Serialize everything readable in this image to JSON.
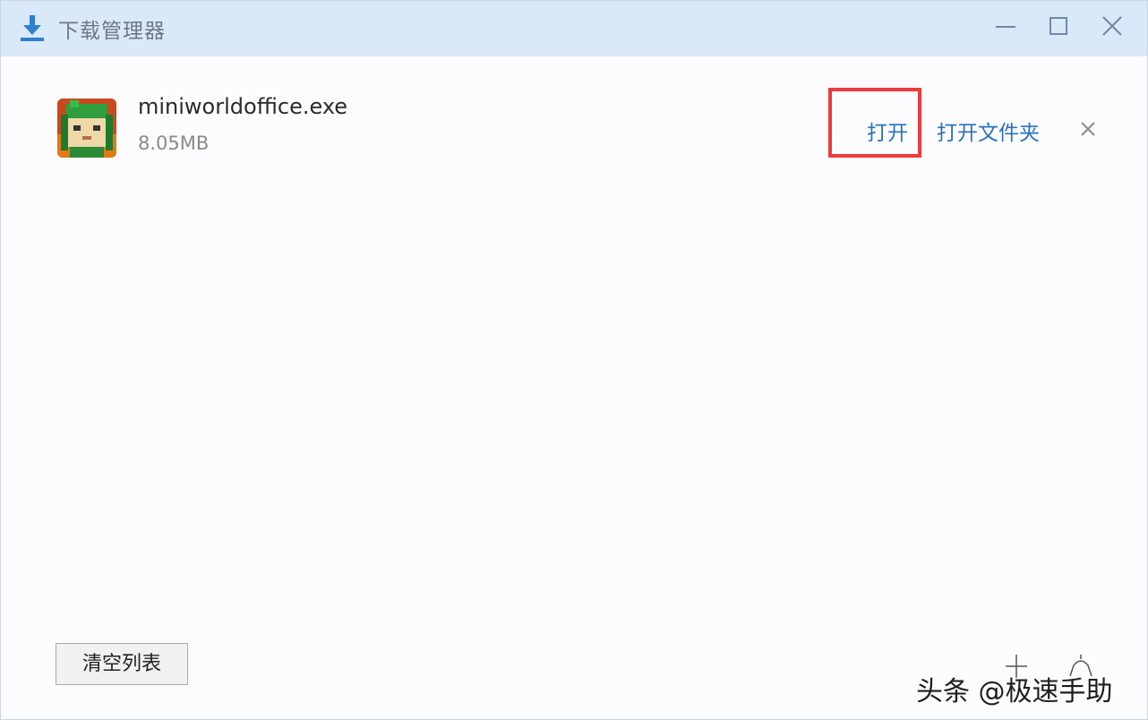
{
  "window": {
    "title": "下载管理器",
    "controls": {
      "minimize": "minimize-icon",
      "maximize": "maximize-icon",
      "close": "close-icon"
    }
  },
  "download_item": {
    "icon": "game-app-icon",
    "file_name": "miniworldoffice.exe",
    "file_size": "8.05MB",
    "open_label": "打开",
    "open_folder_label": "打开文件夹",
    "remove_icon": "close-icon"
  },
  "footer": {
    "clear_list_label": "清空列表"
  },
  "watermark": {
    "text": "头条 @极速手助"
  },
  "colors": {
    "titlebar_bg": "#d9e9f8",
    "accent": "#2a72bd",
    "download_icon": "#2f7fcf",
    "highlight": "#ee3b3b"
  }
}
